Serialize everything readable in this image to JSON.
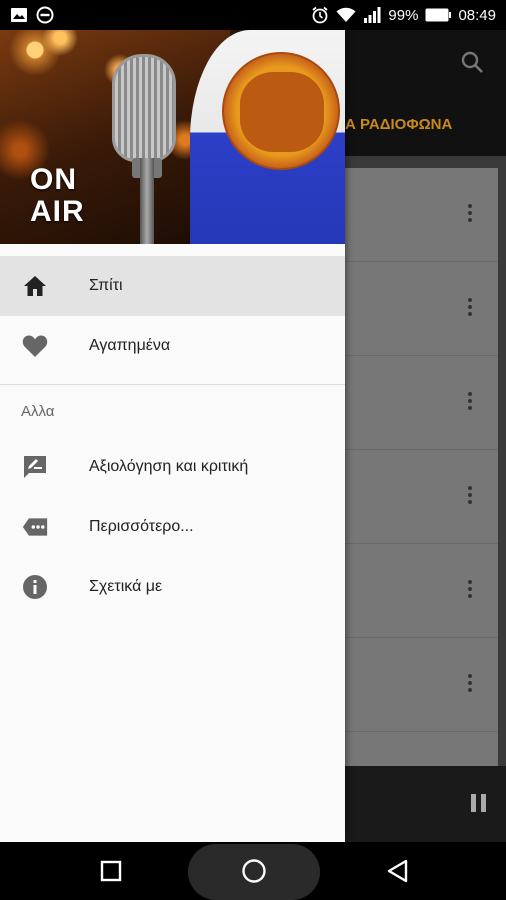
{
  "status_bar": {
    "battery": "99%",
    "time": "08:49",
    "icons": [
      "image-notification-icon",
      "no-entry-icon",
      "alarm-icon",
      "wifi-icon",
      "signal-icon",
      "battery-icon"
    ]
  },
  "background_app": {
    "search_icon": "search-icon",
    "tab_label": "Α ΡΑΔΙΟΦΩΝΑ",
    "tab_color": "#c98a1b",
    "row_count": 6,
    "player_icon": "pause-icon"
  },
  "drawer": {
    "header": {
      "on_air_line1": "ON",
      "on_air_line2": "AIR"
    },
    "items": [
      {
        "label": "Σπίτι",
        "icon": "home-icon",
        "active": true
      },
      {
        "label": "Αγαπημένα",
        "icon": "heart-icon",
        "active": false
      }
    ],
    "section_title": "Αλλα",
    "section_items": [
      {
        "label": "Αξιολόγηση και κριτική",
        "icon": "rate-review-icon"
      },
      {
        "label": "Περισσότερο...",
        "icon": "more-icon"
      },
      {
        "label": "Σχετικά με",
        "icon": "info-icon"
      }
    ]
  },
  "nav_bar": {
    "buttons": [
      "recents-icon",
      "home-button-icon",
      "back-icon"
    ]
  }
}
